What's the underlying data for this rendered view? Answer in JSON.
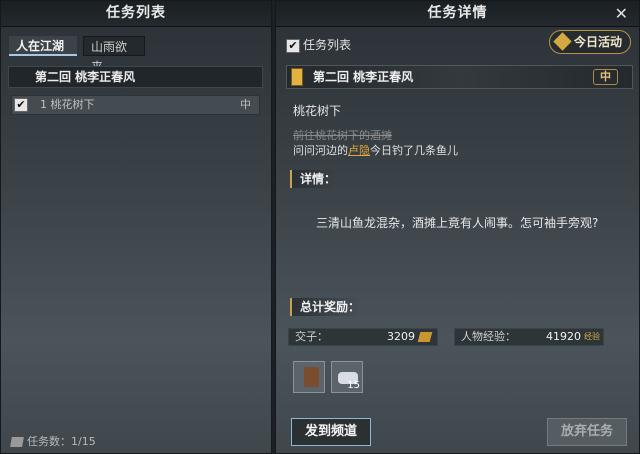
{
  "left_panel": {
    "title": "任务列表",
    "tabs": [
      {
        "label": "人在江湖",
        "active": true
      },
      {
        "label": "山雨欲来",
        "active": false
      }
    ],
    "chapter": "第二回  桃李正春风",
    "tasks": [
      {
        "label": "1 桃花树下",
        "difficulty": "中",
        "checked": true
      }
    ],
    "footer": "任务数：1/15"
  },
  "right_panel": {
    "title": "任务详情",
    "close": "✕",
    "task_list_toggle": "任务列表",
    "today_button": "今日活动",
    "chapter": "第二回  桃李正春风",
    "difficulty": "中",
    "location": "桃花树下",
    "step_done": "前往桃花树下的酒摊",
    "step_current_prefix": "问问河边的",
    "step_current_npc": "卢隐",
    "step_current_suffix": "今日钓了几条鱼儿",
    "detail_title": "详情：",
    "detail_text": "三清山鱼龙混杂，酒摊上竟有人闹事。怎可袖手旁观?",
    "rewards_title": "总计奖励：",
    "rewards": {
      "coin_label": "交子：",
      "coin_value": "3209",
      "exp_label": "人物经验：",
      "exp_value": "41920",
      "exp_icon_text": "经验"
    },
    "items": [
      {
        "icon": "boots-icon",
        "count": ""
      },
      {
        "icon": "cloth-bag-icon",
        "count": "15"
      }
    ],
    "send_button": "发到频道",
    "abandon_button": "放弃任务"
  },
  "colors": {
    "accent_gold": "#d4a843",
    "npc_link": "#e3a83c",
    "active_tab_underline": "#a8c7e6"
  }
}
